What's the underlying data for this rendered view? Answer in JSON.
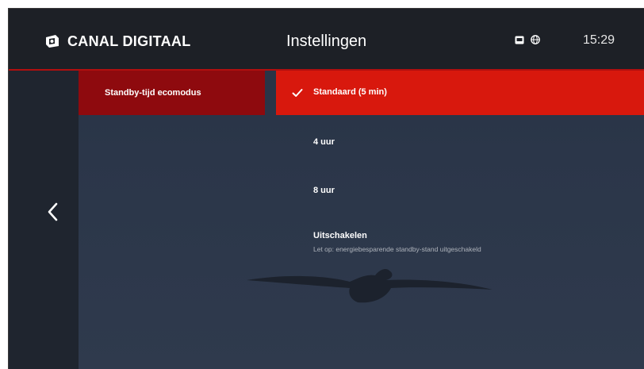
{
  "header": {
    "brand": "CANAL DIGITAAL",
    "title": "Instellingen",
    "time": "15:29",
    "status_icons": [
      "message-icon",
      "globe-icon"
    ]
  },
  "nav": {
    "back_icon": "chevron-left-icon"
  },
  "category": {
    "label": "Standby-tijd ecomodus"
  },
  "options": [
    {
      "label": "Standaard (5 min)",
      "selected": true,
      "note": ""
    },
    {
      "label": "4 uur",
      "selected": false,
      "note": ""
    },
    {
      "label": "8 uur",
      "selected": false,
      "note": ""
    },
    {
      "label": "Uitschakelen",
      "selected": false,
      "note": "Let op: energiebesparende standby-stand uitgeschakeld"
    }
  ],
  "colors": {
    "accent_red": "#d8180d",
    "dark_red": "#8e0a0e",
    "header_bg": "#1d2026",
    "background": "#2b3649"
  }
}
